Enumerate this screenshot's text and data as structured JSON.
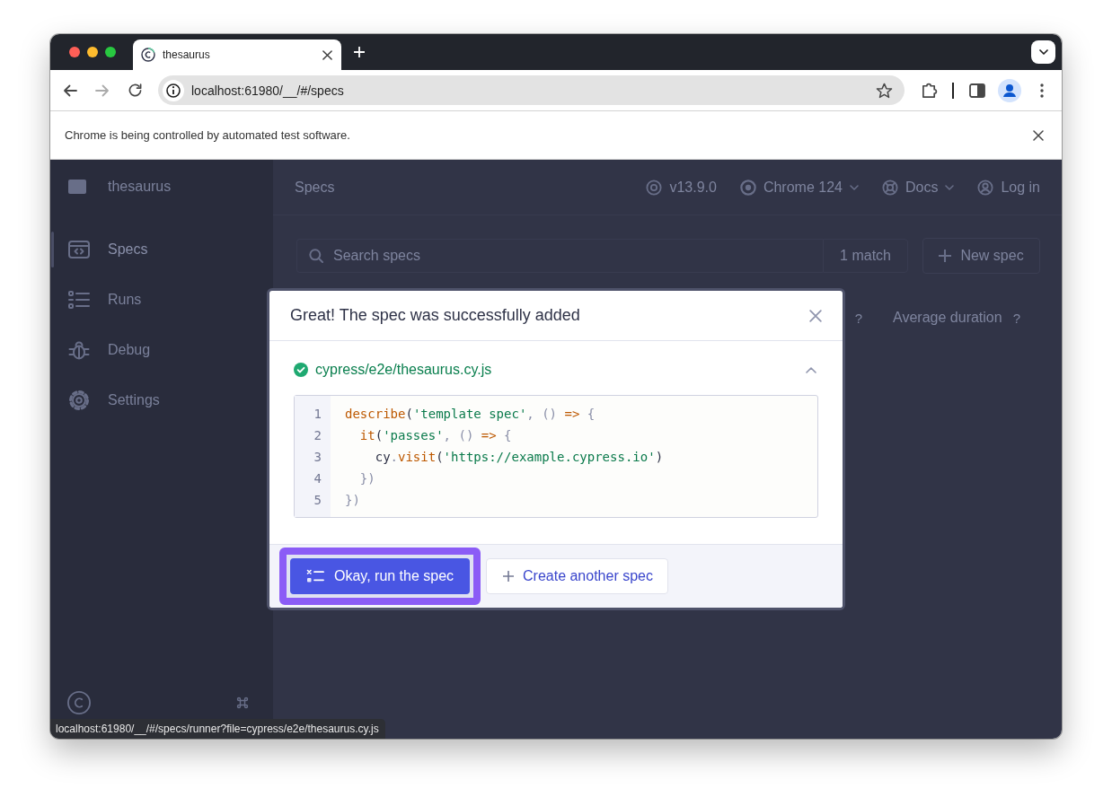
{
  "browser": {
    "tabs": [
      {
        "title": "thesaurus",
        "selected": true
      }
    ],
    "address": "localhost:61980/__/#/specs",
    "infobar": "Chrome is being controlled by automated test software.",
    "status_url": "localhost:61980/__/#/specs/runner?file=cypress/e2e/thesaurus.cy.js"
  },
  "sidebar": {
    "project": "thesaurus",
    "items": [
      {
        "label": "Specs",
        "kind": "specs",
        "selected": true
      },
      {
        "label": "Runs",
        "kind": "runs",
        "selected": false
      },
      {
        "label": "Debug",
        "kind": "debug",
        "selected": false
      },
      {
        "label": "Settings",
        "kind": "settings",
        "selected": false
      }
    ]
  },
  "header": {
    "title": "Specs",
    "items": [
      {
        "label": "v13.9.0",
        "kind": "version"
      },
      {
        "label": "Chrome 124",
        "kind": "browser"
      },
      {
        "label": "Docs",
        "kind": "docs"
      },
      {
        "label": "Log in",
        "kind": "account"
      }
    ]
  },
  "specs_toolbar": {
    "search": {
      "placeholder": "Search specs"
    },
    "match_count": "1 match",
    "new_spec": "New spec"
  },
  "columns": [
    {
      "help": "?"
    },
    {
      "label": "Average duration",
      "help": "?"
    }
  ],
  "dialog": {
    "title": "Great! The spec was successfully added",
    "file": {
      "path": "cypress/e2e/thesaurus.cy.js",
      "expanded": true
    },
    "code": [
      {
        "number": "1",
        "tokens": [
          {
            "text": "describe",
            "kind": "keyword"
          },
          {
            "text": "(",
            "kind": "plain"
          },
          {
            "text": "'template spec'",
            "kind": "string"
          },
          {
            "text": ", () ",
            "kind": "punct"
          },
          {
            "text": "=>",
            "kind": "keyword"
          },
          {
            "text": " {",
            "kind": "punct"
          }
        ]
      },
      {
        "number": "2",
        "tokens": [
          {
            "text": "  it",
            "kind": "keyword"
          },
          {
            "text": "(",
            "kind": "plain"
          },
          {
            "text": "'passes'",
            "kind": "string"
          },
          {
            "text": ", () ",
            "kind": "punct"
          },
          {
            "text": "=>",
            "kind": "keyword"
          },
          {
            "text": " {",
            "kind": "punct"
          }
        ]
      },
      {
        "number": "3",
        "tokens": [
          {
            "text": "    cy",
            "kind": "plain"
          },
          {
            "text": ".",
            "kind": "punct"
          },
          {
            "text": "visit",
            "kind": "keyword"
          },
          {
            "text": "(",
            "kind": "plain"
          },
          {
            "text": "'https://example.cypress.io'",
            "kind": "string"
          },
          {
            "text": ")",
            "kind": "plain"
          }
        ]
      },
      {
        "number": "4",
        "tokens": [
          {
            "text": "  })",
            "kind": "punct"
          }
        ]
      },
      {
        "number": "5",
        "tokens": [
          {
            "text": "})",
            "kind": "punct"
          }
        ]
      }
    ],
    "buttons": [
      {
        "label": "Okay, run the spec",
        "kind": "primary",
        "focused": true
      },
      {
        "label": "Create another spec",
        "kind": "secondary",
        "focused": false
      }
    ]
  }
}
